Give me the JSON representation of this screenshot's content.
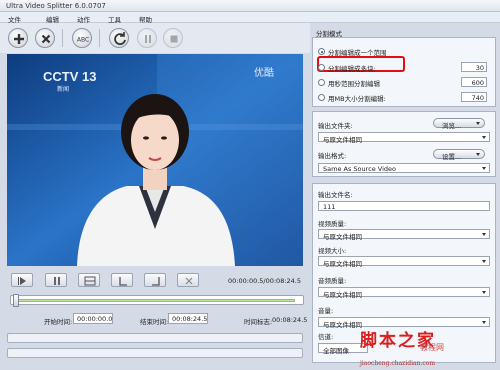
{
  "window": {
    "title": "Ultra Video Splitter 6.0.0707"
  },
  "menu": [
    "文件",
    "编辑",
    "动作",
    "工具",
    "帮助"
  ],
  "toolbar": {
    "buttons": [
      "add-icon",
      "remove-icon",
      "abc-icon",
      "refresh-icon",
      "pause-icon",
      "stop-icon"
    ],
    "abc_label": "ABC"
  },
  "video": {
    "channel_logo": "CCTV 13",
    "channel_sub": "新闻",
    "corner_logo": "优酷"
  },
  "playback": {
    "time_display": "00:00:00.5/00:08:24.5"
  },
  "times": {
    "start_label": "开始时间:",
    "start_value": "00:00:00.0",
    "end_label": "结束时间:",
    "end_value": "00:08:24.5",
    "mark_label": "时间标志:",
    "mark_value": "00:08:24.5"
  },
  "slider": {
    "progress": 0.98
  },
  "split_mode": {
    "title": "分割模式",
    "options": [
      {
        "label": "分割编辑成一个范围",
        "selected": true
      },
      {
        "label": "分割编辑成多块:",
        "value": "30"
      },
      {
        "label": "用秒范围分割编辑",
        "value": "600"
      },
      {
        "label": "用MB大小分割编辑:",
        "value": "740"
      }
    ]
  },
  "output": {
    "folder_label": "输出文件夹:",
    "browse_button": "浏览...",
    "folder_value": "与原文件相同",
    "format_label": "输出格式:",
    "settings_button": "设置...",
    "format_value": "Same As Source Video",
    "filename_label": "输出文件名:",
    "filename_value": "111",
    "video_quality_label": "视频质量:",
    "video_quality_value": "与原文件相同",
    "video_size_label": "视频大小:",
    "video_size_value": "与原文件相同",
    "audio_quality_label": "音频质量:",
    "audio_quality_value": "与原文件相同",
    "volume_label": "音量:",
    "volume_value": "与原文件相同",
    "channel_label": "信道:",
    "channel_value": "全部图像"
  },
  "watermark": {
    "text": "脚本之家",
    "sub": "教程网",
    "url": "jiaocheng.chazidian.com"
  },
  "colors": {
    "accent": "#1e5da8",
    "highlight_box": "#e01010",
    "slider_fill": "#b9e29c"
  }
}
